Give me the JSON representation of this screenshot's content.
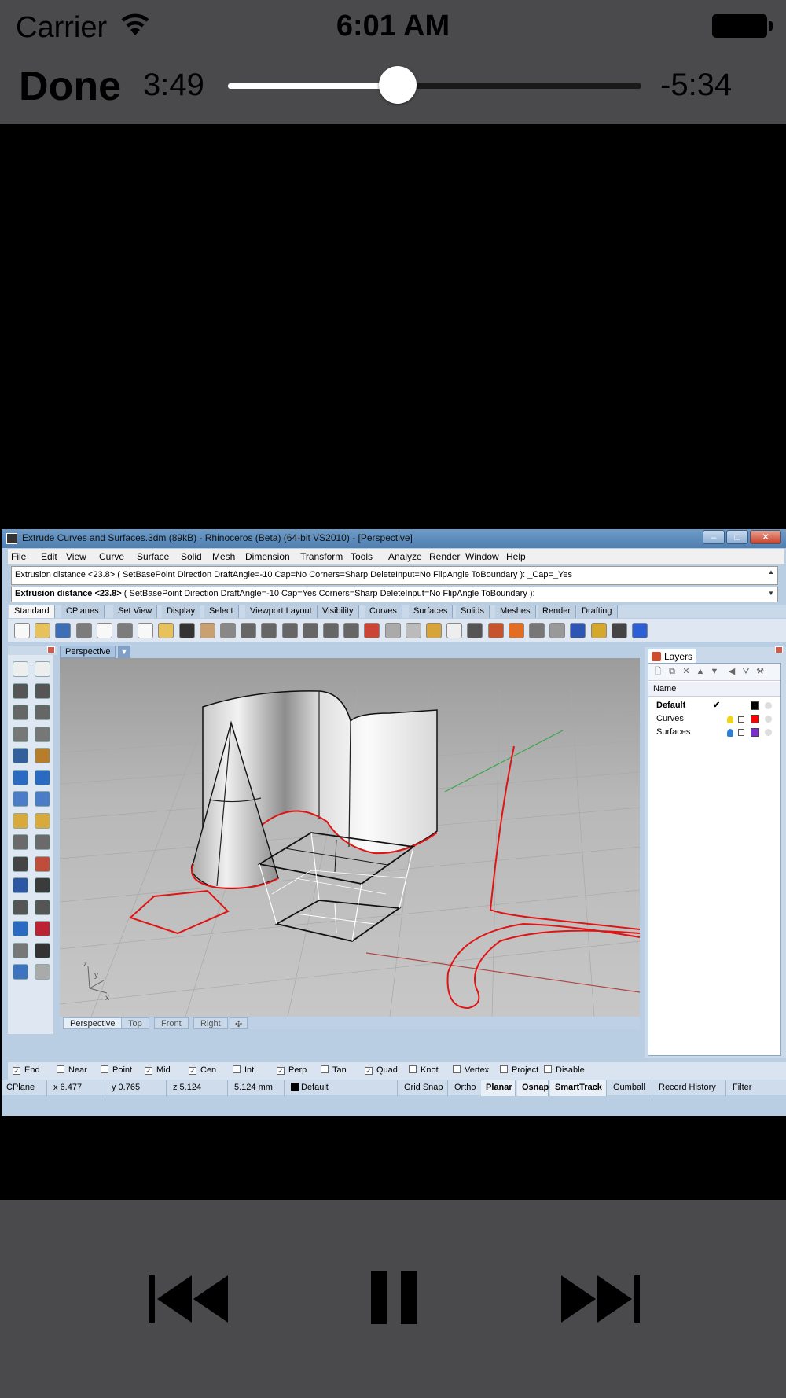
{
  "status_bar": {
    "carrier": "Carrier",
    "time": "6:01 AM"
  },
  "player": {
    "done_label": "Done",
    "elapsed": "3:49",
    "remaining": "-5:34",
    "progress": 0.41
  },
  "rhino": {
    "window_title": "Extrude Curves and Surfaces.3dm (89kB) - Rhinoceros (Beta) (64-bit VS2010) - [Perspective]",
    "menu": [
      "File",
      "Edit",
      "View",
      "Curve",
      "Surface",
      "Solid",
      "Mesh",
      "Dimension",
      "Transform",
      "Tools",
      "Analyze",
      "Render",
      "Window",
      "Help"
    ],
    "command_history": "Extrusion distance <23.8> ( SetBasePoint  Direction  DraftAngle=-10  Cap=No  Corners=Sharp  DeleteInput=No  FlipAngle  ToBoundary ): _Cap=_Yes",
    "command_prompt": "Extrusion distance <23.8>",
    "command_options": " ( SetBasePoint  Direction  DraftAngle=-10  Cap=Yes  Corners=Sharp  DeleteInput=No  FlipAngle  ToBoundary ):",
    "toolbar_tabs": [
      "Standard",
      "CPlanes",
      "Set View",
      "Display",
      "Select",
      "Viewport Layout",
      "Visibility",
      "Curves",
      "Surfaces",
      "Solids",
      "Meshes",
      "Render",
      "Drafting"
    ],
    "viewport_title": "Perspective",
    "viewport_tabs": [
      "Perspective",
      "Top",
      "Front",
      "Right"
    ],
    "axis_labels": {
      "z": "z",
      "y": "y",
      "x": "x"
    },
    "layers_panel": {
      "tab_label": "Layers",
      "column_name": "Name",
      "layers": [
        {
          "name": "Default",
          "current": true,
          "bulb_color": "",
          "color": "#000000"
        },
        {
          "name": "Curves",
          "current": false,
          "bulb_color": "#f2d31b",
          "color": "#ff0000"
        },
        {
          "name": "Surfaces",
          "current": false,
          "bulb_color": "#2f7fd6",
          "color": "#7b2fd1"
        }
      ]
    },
    "osnaps": [
      {
        "label": "End",
        "checked": true
      },
      {
        "label": "Near",
        "checked": false
      },
      {
        "label": "Point",
        "checked": false
      },
      {
        "label": "Mid",
        "checked": true
      },
      {
        "label": "Cen",
        "checked": true
      },
      {
        "label": "Int",
        "checked": false
      },
      {
        "label": "Perp",
        "checked": true
      },
      {
        "label": "Tan",
        "checked": false
      },
      {
        "label": "Quad",
        "checked": true
      },
      {
        "label": "Knot",
        "checked": false
      },
      {
        "label": "Vertex",
        "checked": false
      },
      {
        "label": "Project",
        "checked": false
      },
      {
        "label": "Disable",
        "checked": false
      }
    ],
    "status": {
      "cplane": "CPlane",
      "x": "x 6.477",
      "y": "y 0.765",
      "z": "z 5.124",
      "distance": "5.124 mm",
      "layer": "Default",
      "toggles": [
        "Grid Snap",
        "Ortho",
        "Planar",
        "Osnap",
        "SmartTrack",
        "Gumball",
        "Record History",
        "Filter"
      ]
    },
    "colors": {
      "curve_red": "#e01414",
      "title_blue": "#5a88bb"
    }
  },
  "controls": {
    "previous_icon": "skip-back-icon",
    "pause_icon": "pause-icon",
    "next_icon": "skip-forward-icon"
  }
}
